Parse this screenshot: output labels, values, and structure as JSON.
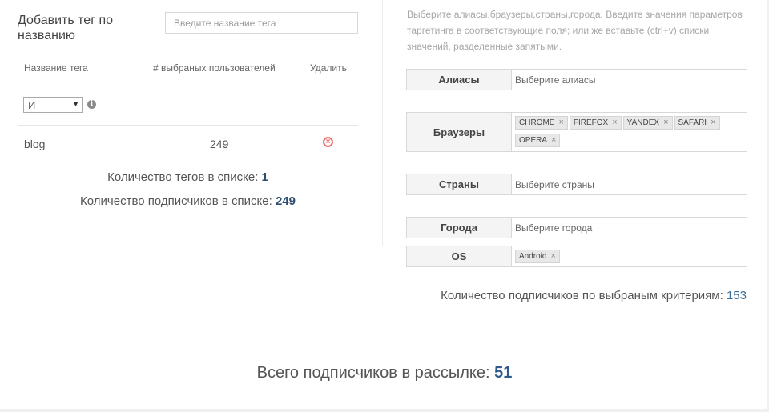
{
  "tags_panel": {
    "title": "Добавить тег по названию",
    "search_placeholder": "Введите название тега",
    "columns": [
      "Название тега",
      "# выбраных пользователей",
      "Удалить"
    ],
    "operator_select": "И",
    "rows": [
      {
        "name": "blog",
        "count": "249"
      }
    ],
    "tags_count_label": "Количество тегов в списке:",
    "tags_count": "1",
    "subscribers_label": "Количество подписчиков в списке:",
    "subscribers_count": "249"
  },
  "targeting": {
    "instructions": "Выберите алиасы,браузеры,страны,города. Введите значения параметров таргетинга в соответствующие поля; или же вставьте (ctrl+v) списки значений, разделенные запятыми.",
    "aliases": {
      "label": "Алиасы",
      "placeholder": "Выберите алиасы"
    },
    "browsers": {
      "label": "Браузеры",
      "chips": [
        "CHROME",
        "FIREFOX",
        "YANDEX",
        "SAFARI",
        "OPERA"
      ]
    },
    "countries": {
      "label": "Страны",
      "placeholder": "Выберите страны"
    },
    "cities": {
      "label": "Города",
      "placeholder": "Выберите города"
    },
    "os": {
      "label": "OS",
      "chips": [
        "Android"
      ]
    },
    "criteria_label": "Количество подписчиков по выбраным критериям:",
    "criteria_count": "153"
  },
  "total": {
    "label": "Всего подписчиков в рассылке:",
    "count": "51"
  },
  "colors": {
    "accent_blue": "#2d5a8a",
    "remove_red": "#e8716b"
  }
}
